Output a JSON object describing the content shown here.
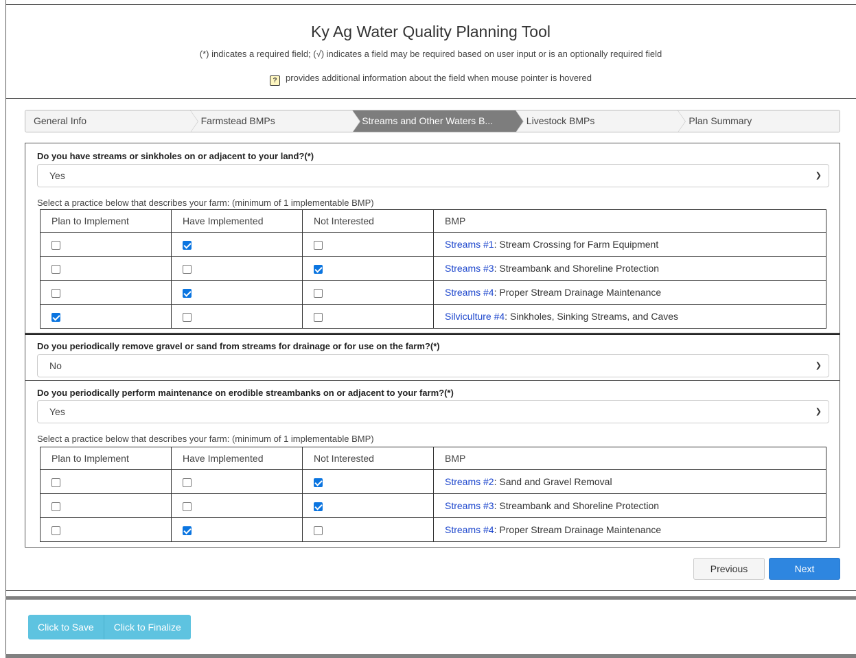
{
  "header": {
    "title": "Ky Ag Water Quality Planning Tool",
    "subtitle": "(*) indicates a required field; (√) indicates a field may be required based on user input or is an optionally required field",
    "hint": "provides additional information about the field when mouse pointer is hovered"
  },
  "wizard": {
    "steps": [
      {
        "label": "General Info",
        "active": false
      },
      {
        "label": "Farmstead BMPs",
        "active": false
      },
      {
        "label": "Streams and Other Waters B...",
        "active": true
      },
      {
        "label": "Livestock BMPs",
        "active": false
      },
      {
        "label": "Plan Summary",
        "active": false
      }
    ]
  },
  "columns": [
    "Plan to Implement",
    "Have Implemented",
    "Not Interested",
    "BMP"
  ],
  "sections": [
    {
      "question": "Do you have streams or sinkholes on or adjacent to your land?(*)",
      "answer": "Yes",
      "caption": "Select a practice below that describes your farm: (minimum of 1 implementable BMP)",
      "rows": [
        {
          "plan": false,
          "have": true,
          "not": false,
          "link": "Streams #1",
          "desc": ": Stream Crossing for Farm Equipment"
        },
        {
          "plan": false,
          "have": false,
          "not": true,
          "link": "Streams #3",
          "desc": ": Streambank and Shoreline Protection"
        },
        {
          "plan": false,
          "have": true,
          "not": false,
          "link": "Streams #4",
          "desc": ": Proper Stream Drainage Maintenance"
        },
        {
          "plan": true,
          "have": false,
          "not": false,
          "link": "Silviculture #4",
          "desc": ": Sinkholes, Sinking Streams, and Caves"
        }
      ]
    },
    {
      "question": "Do you periodically remove gravel or sand from streams for drainage or for use on the farm?(*)",
      "answer": "No"
    },
    {
      "question": "Do you periodically perform maintenance on erodible streambanks on or adjacent to your farm?(*)",
      "answer": "Yes",
      "caption": "Select a practice below that describes your farm: (minimum of 1 implementable BMP)",
      "rows": [
        {
          "plan": false,
          "have": false,
          "not": true,
          "link": "Streams #2",
          "desc": ": Sand and Gravel Removal"
        },
        {
          "plan": false,
          "have": false,
          "not": true,
          "link": "Streams #3",
          "desc": ": Streambank and Shoreline Protection"
        },
        {
          "plan": false,
          "have": true,
          "not": false,
          "link": "Streams #4",
          "desc": ": Proper Stream Drainage Maintenance"
        }
      ]
    }
  ],
  "nav": {
    "previous": "Previous",
    "next": "Next"
  },
  "actions": {
    "save": "Click to Save",
    "finalize": "Click to Finalize"
  },
  "colors": {
    "link": "#1a44cc",
    "next_button": "#2e86e0",
    "save_buttons": "#5ec3e0",
    "active_step": "#7d7d7d"
  }
}
